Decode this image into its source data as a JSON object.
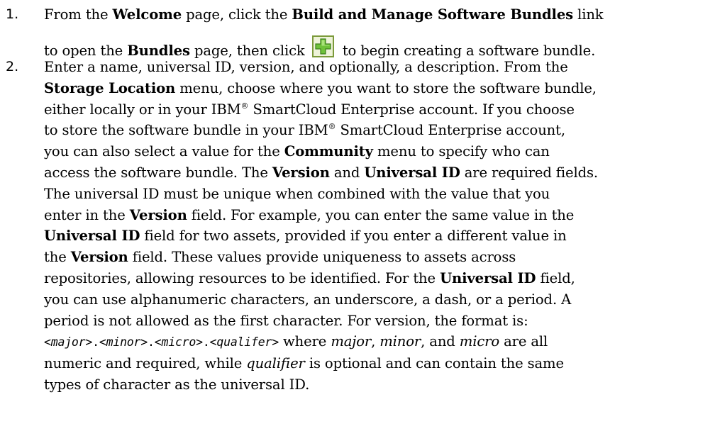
{
  "steps": [
    {
      "number": "1.",
      "t1": "From the ",
      "b1": "Welcome",
      "t2": " page, click the ",
      "b2": "Build and Manage Software Bundles",
      "t3": " link",
      "t4": "to open the ",
      "b3": "Bundles",
      "t5": " page, then click ",
      "icon": "add-icon",
      "t6": " to begin creating a software bundle."
    },
    {
      "number": "2.",
      "t1": "Enter a name, universal ID, version, and optionally, a description. From the",
      "b1": "Storage Location",
      "t2": " menu, choose where you want to store the software bundle,",
      "t3": "either locally or in your IBM",
      "reg1": "®",
      "t4": " SmartCloud Enterprise account. If you choose",
      "t5": "to store the software bundle in your IBM",
      "reg2": "®",
      "t6": " SmartCloud Enterprise account,",
      "t7": "you can also select a value for the ",
      "b2": "Community",
      "t8": " menu to specify who can",
      "t9": "access the software bundle. The ",
      "b3": "Version",
      "t10": " and ",
      "b4": "Universal ID",
      "t11": " are required fields.",
      "t12": "The universal ID must be unique when combined with the value that you",
      "t13": "enter in the ",
      "b5": "Version",
      "t14": " field. For example, you can enter the same value in the",
      "b6": "Universal ID",
      "t15": " field for two assets, provided if you enter a different value in",
      "t16": "the ",
      "b7": "Version",
      "t17": " field. These values provide uniqueness to assets across",
      "t18": "repositories, allowing resources to be identified. For the ",
      "b8": "Universal ID",
      "t19": " field,",
      "t20": "you can use alphanumeric characters, an underscore, a dash, or a period. A",
      "t21": "period is not allowed as the first character. For version, the format is:",
      "m1": "<",
      "mi1": "major",
      "m2": ">.<",
      "mi2": "minor",
      "m3": ">.<",
      "mi3": "micro",
      "m4": ">.<",
      "mi4": "qualifer",
      "m5": ">",
      "t22": " where ",
      "i1": "major",
      "t23": ", ",
      "i2": "minor",
      "t24": ", and ",
      "i3": "micro",
      "t25": " are all",
      "t26": "numeric and required, while ",
      "i4": "qualifier",
      "t27": " is optional and can contain the same",
      "t28": "types of character as the universal ID."
    }
  ]
}
